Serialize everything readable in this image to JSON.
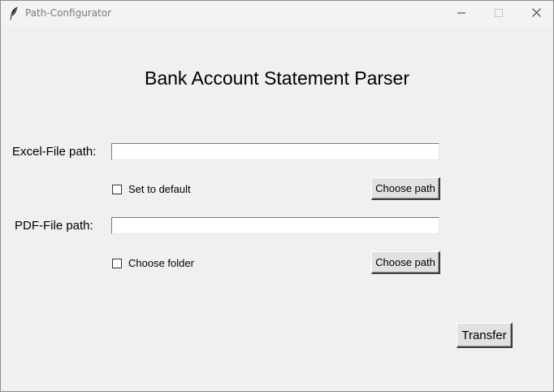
{
  "window": {
    "title": "Path-Configurator",
    "icon": "feather-icon",
    "controls": [
      "minimize-icon",
      "maximize-icon",
      "close-icon"
    ]
  },
  "main": {
    "heading": "Bank Account Statement Parser",
    "excel": {
      "label": "Excel-File path:",
      "value": "",
      "checkbox_label": "Set to default",
      "checkbox_checked": false,
      "button_label": "Choose path"
    },
    "pdf": {
      "label": "PDF-File path:",
      "value": "",
      "checkbox_label": "Choose folder",
      "checkbox_checked": false,
      "button_label": "Choose path"
    },
    "transfer_label": "Transfer"
  }
}
